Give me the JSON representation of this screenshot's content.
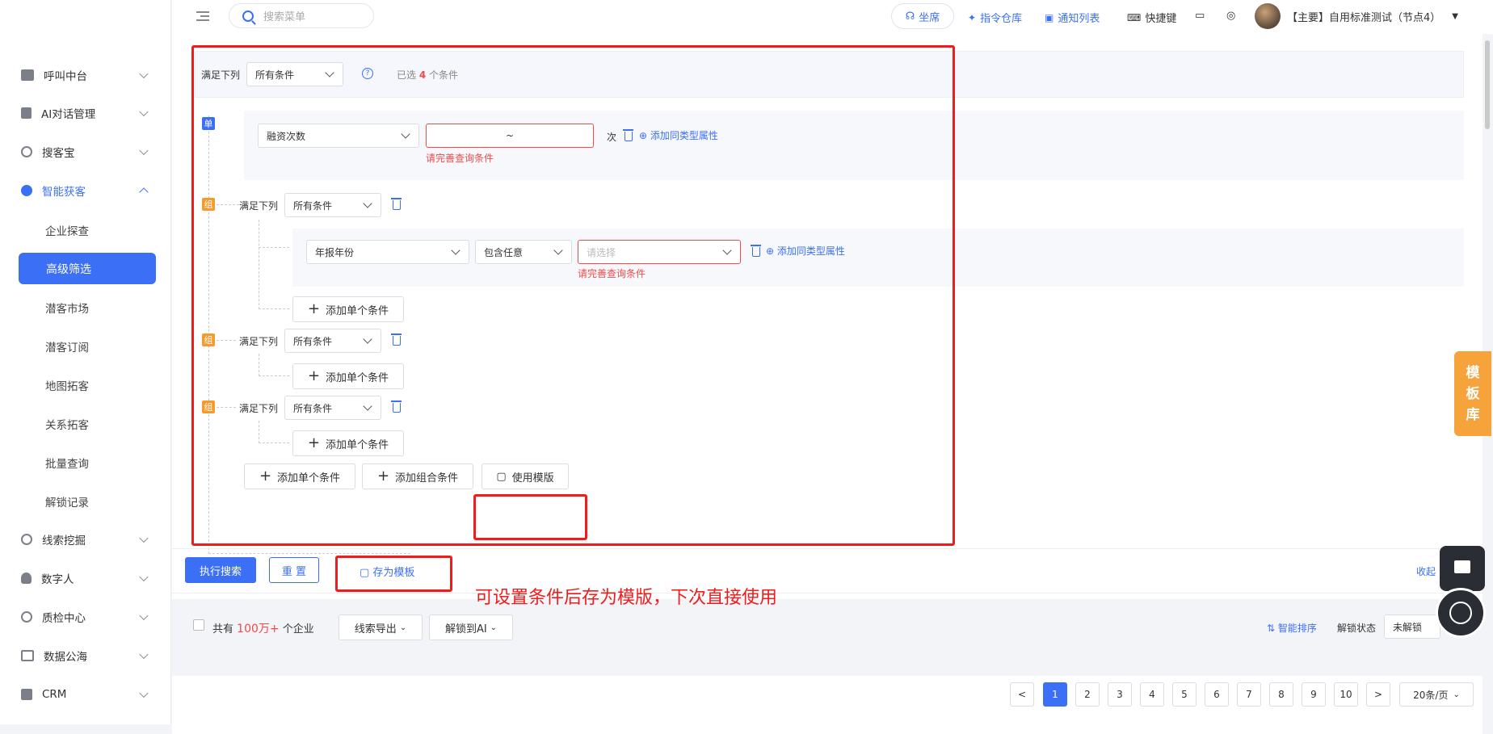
{
  "sidebar": {
    "items": [
      {
        "label": "呼叫中台",
        "icon": "phone-monitor-icon"
      },
      {
        "label": "AI对话管理",
        "icon": "ai-dialog-icon"
      },
      {
        "label": "搜客宝",
        "icon": "search-client-icon"
      },
      {
        "label": "智能获客",
        "icon": "smart-acquire-icon"
      },
      {
        "label": "线索挖掘",
        "icon": "lead-mining-icon"
      },
      {
        "label": "数字人",
        "icon": "digital-human-icon"
      },
      {
        "label": "质检中心",
        "icon": "quality-icon"
      },
      {
        "label": "数据公海",
        "icon": "data-pool-icon"
      },
      {
        "label": "CRM",
        "icon": "crm-icon"
      }
    ],
    "subitems": [
      "企业探查",
      "高级筛选",
      "潜客市场",
      "潜客订阅",
      "地图拓客",
      "关系拓客",
      "批量查询",
      "解锁记录"
    ]
  },
  "topbar": {
    "search_placeholder": "搜索菜单",
    "seat": "坐席",
    "cmd": "指令仓库",
    "notice": "通知列表",
    "shortcut": "快捷键",
    "user": "【主要】自用标准测试（节点4）"
  },
  "filter": {
    "head_label": "满足下列",
    "head_select": "所有条件",
    "selected_prefix": "已选",
    "selected_count": "4",
    "selected_suffix": "个条件",
    "single_badge": "单",
    "group_badge": "组",
    "cond1": {
      "field": "融资次数",
      "range_sep": "~",
      "unit": "次",
      "add_same": "添加同类型属性",
      "error": "请完善查询条件"
    },
    "group_label": "满足下列",
    "group_select": "所有条件",
    "cond2": {
      "field": "年报年份",
      "op": "包含任意",
      "placeholder": "请选择",
      "add_same": "添加同类型属性",
      "error": "请完善查询条件"
    },
    "add_single": "添加单个条件",
    "add_combo": "添加组合条件",
    "use_template": "使用模版"
  },
  "actions": {
    "search": "执行搜索",
    "reset": "重 置",
    "save_template": "存为模板",
    "collapse": "收起"
  },
  "annotation": "可设置条件后存为模版，下次直接使用",
  "results": {
    "total_prefix": "共有",
    "total": "100万+",
    "total_suffix": "个企业",
    "export": "线索导出",
    "unlock_ai": "解锁到AI",
    "smart_sort": "智能排序",
    "unlock_status_label": "解锁状态",
    "unlock_status": "未解锁"
  },
  "pagination": {
    "pages": [
      "1",
      "2",
      "3",
      "4",
      "5",
      "6",
      "7",
      "8",
      "9",
      "10"
    ],
    "current": "1",
    "prev": "<",
    "next": ">",
    "page_size": "20条/页"
  },
  "template_tab": [
    "模",
    "板",
    "库"
  ],
  "colors": {
    "accent": "#3b6ff5",
    "annotation": "#f01b1b",
    "group_badge": "#f79a2d"
  }
}
